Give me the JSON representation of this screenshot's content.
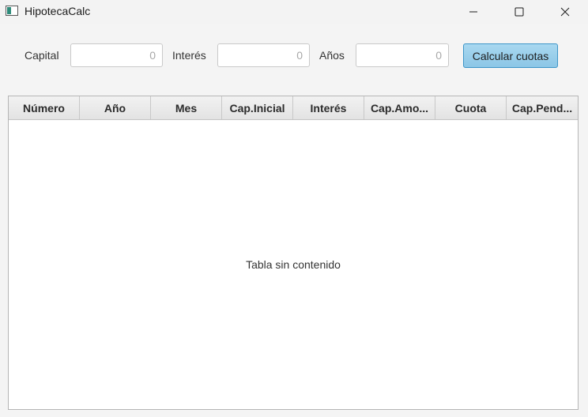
{
  "window": {
    "title": "HipotecaCalc",
    "icon": "app-window-icon",
    "controls": [
      "minimize-icon",
      "maximize-icon",
      "close-icon"
    ]
  },
  "form": {
    "capital_label": "Capital",
    "capital_value": "",
    "capital_placeholder": "0",
    "interes_label": "Interés",
    "interes_value": "",
    "interes_placeholder": "0",
    "anos_label": "Años",
    "anos_value": "",
    "anos_placeholder": "0",
    "calc_button_label": "Calcular cuotas"
  },
  "table": {
    "columns": [
      "Número",
      "Año",
      "Mes",
      "Cap.Inicial",
      "Interés",
      "Cap.Amo...",
      "Cuota",
      "Cap.Pend..."
    ],
    "rows": [],
    "empty_message": "Tabla sin contenido"
  },
  "colors": {
    "accent_button": "#a9d8f0",
    "accent_border": "#3d95c8"
  }
}
